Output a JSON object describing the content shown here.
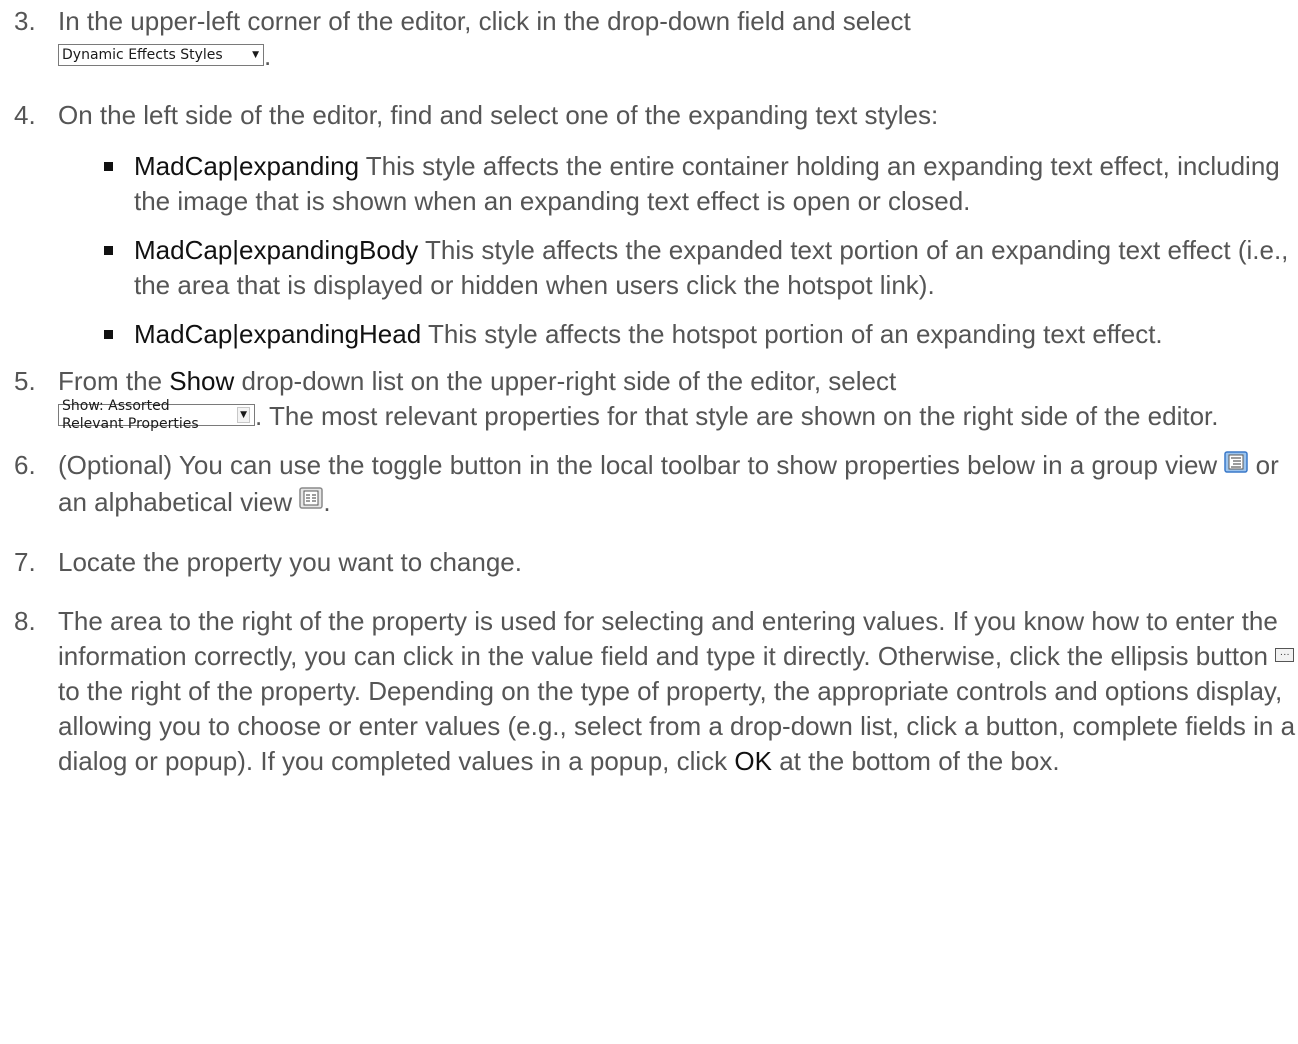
{
  "steps": [
    {
      "number": "3.",
      "text_before": "In the upper-left corner of the editor, click in the drop-down field and select ",
      "dropdown_label": "Dynamic Effects Styles",
      "text_after": "."
    },
    {
      "number": "4.",
      "text": "On the left side of the editor, find and select one of the expanding text styles:",
      "bullets": [
        {
          "term": "MadCap|expanding",
          "description": " This style affects the entire container holding an expanding text effect, including the image that is shown when an expanding text effect is open or closed."
        },
        {
          "term": "MadCap|expandingBody",
          "description": " This style affects the expanded text portion of an expanding text effect (i.e., the area that is displayed or hidden when users click the hotspot link)."
        },
        {
          "term": "MadCap|expandingHead",
          "description": " This style affects the hotspot portion of an expanding text effect."
        }
      ]
    },
    {
      "number": "5.",
      "text_before": "From the ",
      "highlight": "Show",
      "text_middle": " drop-down list on the upper-right side of the editor, select ",
      "dropdown_label": "Show: Assorted Relevant Properties",
      "text_after": ". The most relevant properties for that style are shown on the right side of the editor."
    },
    {
      "number": "6.",
      "text_before": "(Optional) You can use the toggle button in the local toolbar to show properties below in a group view ",
      "icon_group": "group-view-icon",
      "text_middle": " or an alphabetical view ",
      "icon_alpha": "alphabetical-view-icon",
      "text_after": "."
    },
    {
      "number": "7.",
      "text": "Locate the property you want to change."
    },
    {
      "number": "8.",
      "text_before": "The area to the right of the property is used for selecting and entering values. If you know how to enter the information correctly, you can click in the value field and type it directly. Otherwise, click the ellipsis button ",
      "ellipsis_label": "···",
      "text_middle": " to the right of the property. Depending on the type of property, the appropriate controls and options display, allowing you to choose or enter values (e.g., select from a drop-down list, click a button, complete fields in a dialog or popup). If you completed values in a popup, click ",
      "highlight": "OK",
      "text_after": " at the bottom of the box."
    }
  ],
  "colors": {
    "body_text": "#555555",
    "highlight_text": "#111111",
    "icon_blue": "#3a78c8"
  }
}
